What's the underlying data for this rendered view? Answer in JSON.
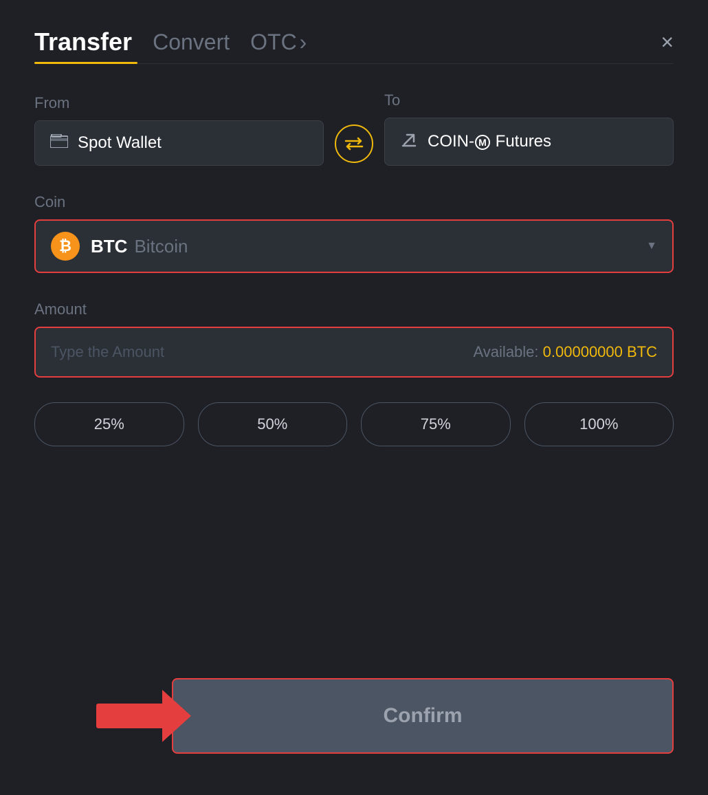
{
  "header": {
    "tab_transfer": "Transfer",
    "tab_convert": "Convert",
    "tab_otc": "OTC",
    "otc_arrow": "›",
    "close_label": "×"
  },
  "from_section": {
    "label": "From",
    "wallet_icon": "▬",
    "wallet_name": "Spot Wallet"
  },
  "to_section": {
    "label": "To",
    "futures_icon": "↑",
    "futures_name": "COIN-",
    "futures_m": "M",
    "futures_suffix": " Futures"
  },
  "swap": {
    "icon": "⇄"
  },
  "coin_section": {
    "label": "Coin",
    "coin_symbol": "BTC",
    "coin_name": "Bitcoin",
    "btc_symbol": "₿",
    "dropdown_arrow": "▼"
  },
  "amount_section": {
    "label": "Amount",
    "placeholder": "Type the Amount",
    "available_label": "Available:",
    "available_value": "0.00000000 BTC"
  },
  "pct_buttons": {
    "btn25": "25%",
    "btn50": "50%",
    "btn75": "75%",
    "btn100": "100%"
  },
  "confirm": {
    "label": "Confirm"
  },
  "colors": {
    "accent": "#f0b90b",
    "danger": "#e53e3e",
    "bg": "#1e2026",
    "surface": "#2b2f36"
  }
}
